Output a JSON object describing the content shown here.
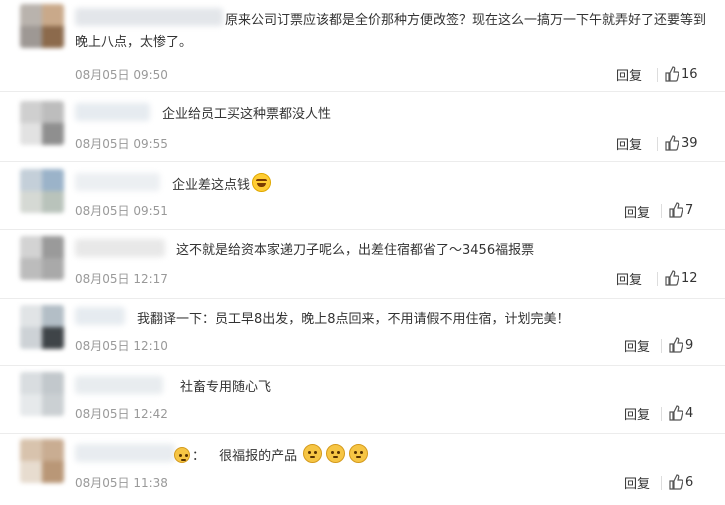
{
  "colors": {
    "meta_text": "#999999",
    "body_text": "#333333",
    "divider": "#ececec"
  },
  "comments": [
    {
      "text": "原来公司订票应该都是全价那种方便改签？现在这么一搞万一下午就弄好了还要等到晚上八点，太惨了。",
      "time": "08月05日 09:50",
      "reply": "回复",
      "likes": "16",
      "like_icon": "thumbs-up-icon"
    },
    {
      "text": "企业给员工买这种票都没人性",
      "time": "08月05日 09:55",
      "reply": "回复",
      "likes": "39",
      "like_icon": "thumbs-up-icon"
    },
    {
      "text": "企业差这点钱",
      "emoji": "laughing-tears-emoji",
      "time": "08月05日 09:51",
      "reply": "回复",
      "likes": "7",
      "like_icon": "thumbs-up-icon"
    },
    {
      "text": "这不就是给资本家递刀子呢么，出差住宿都省了～3456福报票",
      "time": "08月05日 12:17",
      "reply": "回复",
      "likes": "12",
      "like_icon": "thumbs-up-icon"
    },
    {
      "text": "我翻译一下：员工早8出发，晚上8点回来，不用请假不用住宿，计划完美！",
      "time": "08月05日 12:10",
      "reply": "回复",
      "likes": "9",
      "like_icon": "thumbs-up-icon"
    },
    {
      "text": "社畜专用随心飞",
      "time": "08月05日 12:42",
      "reply": "回复",
      "likes": "4",
      "like_icon": "thumbs-up-icon"
    },
    {
      "prefix": "：",
      "text": "很福报的产品",
      "emoji": "cat-face-emoji",
      "time": "08月05日 11:38",
      "reply": "回复",
      "likes": "6",
      "like_icon": "thumbs-up-icon"
    }
  ]
}
